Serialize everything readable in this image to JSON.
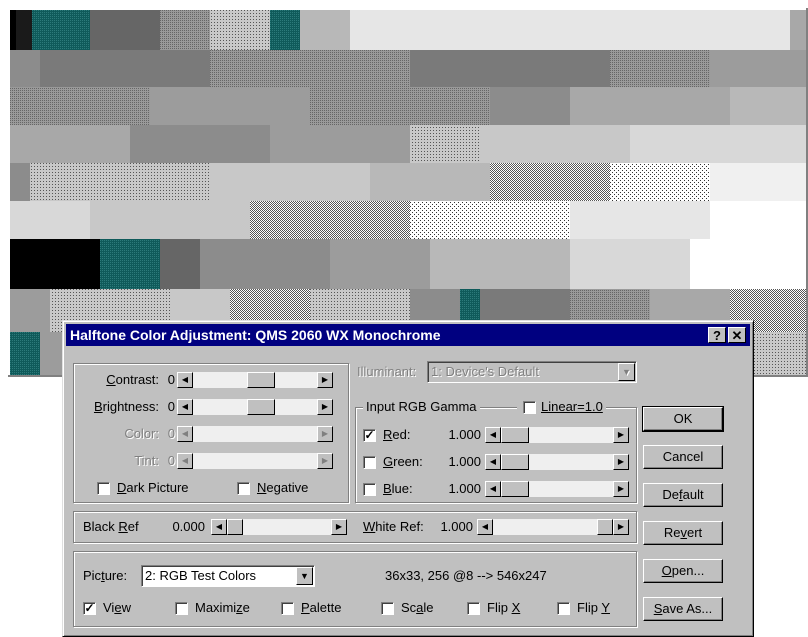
{
  "dialog": {
    "title": "Halftone Color Adjustment: QMS 2060 WX Monochrome",
    "help_label": "?",
    "close_label": "✕"
  },
  "adjust": {
    "contrast": {
      "label": "Contrast:",
      "value": "0",
      "enabled": true
    },
    "brightness": {
      "label": "Brightness:",
      "value": "0",
      "enabled": true
    },
    "color": {
      "label": "Color:",
      "value": "0",
      "enabled": false
    },
    "tint": {
      "label": "Tint:",
      "value": "0",
      "enabled": false
    },
    "dark_picture": {
      "label": "Dark Picture",
      "checked": false
    },
    "negative": {
      "label": "Negative",
      "checked": false
    }
  },
  "illuminant": {
    "label": "Illuminant:",
    "value": "1: Device's Default",
    "enabled": false
  },
  "gamma": {
    "title": "Input RGB Gamma",
    "linear": {
      "label": "Linear=1.0",
      "checked": false
    },
    "red": {
      "label": "Red:",
      "value": "1.000",
      "checked": true
    },
    "green": {
      "label": "Green:",
      "value": "1.000",
      "checked": false
    },
    "blue": {
      "label": "Blue:",
      "value": "1.000",
      "checked": false
    }
  },
  "ref": {
    "black_label": "Black Ref",
    "black_value": "0.000",
    "white_label": "White Ref:",
    "white_value": "1.000"
  },
  "picture": {
    "label": "Picture:",
    "selected": "2: RGB Test Colors",
    "info": "36x33, 256 @8 --> 546x247"
  },
  "options": {
    "view": {
      "label": "View",
      "checked": true
    },
    "maximize": {
      "label": "Maximize",
      "checked": false
    },
    "palette": {
      "label": "Palette",
      "checked": false
    },
    "scale": {
      "label": "Scale",
      "checked": false
    },
    "flip_x": {
      "label": "Flip X",
      "checked": false
    },
    "flip_y": {
      "label": "Flip Y",
      "checked": false
    }
  },
  "buttons": {
    "ok": "OK",
    "cancel": "Cancel",
    "default": "Default",
    "revert": "Revert",
    "open": "Open...",
    "save_as": "Save As..."
  },
  "check_glyph": "✓",
  "colors": {
    "title_bar": "#000080",
    "face": "#c0c0c0",
    "teal": "#0a4a4a"
  }
}
